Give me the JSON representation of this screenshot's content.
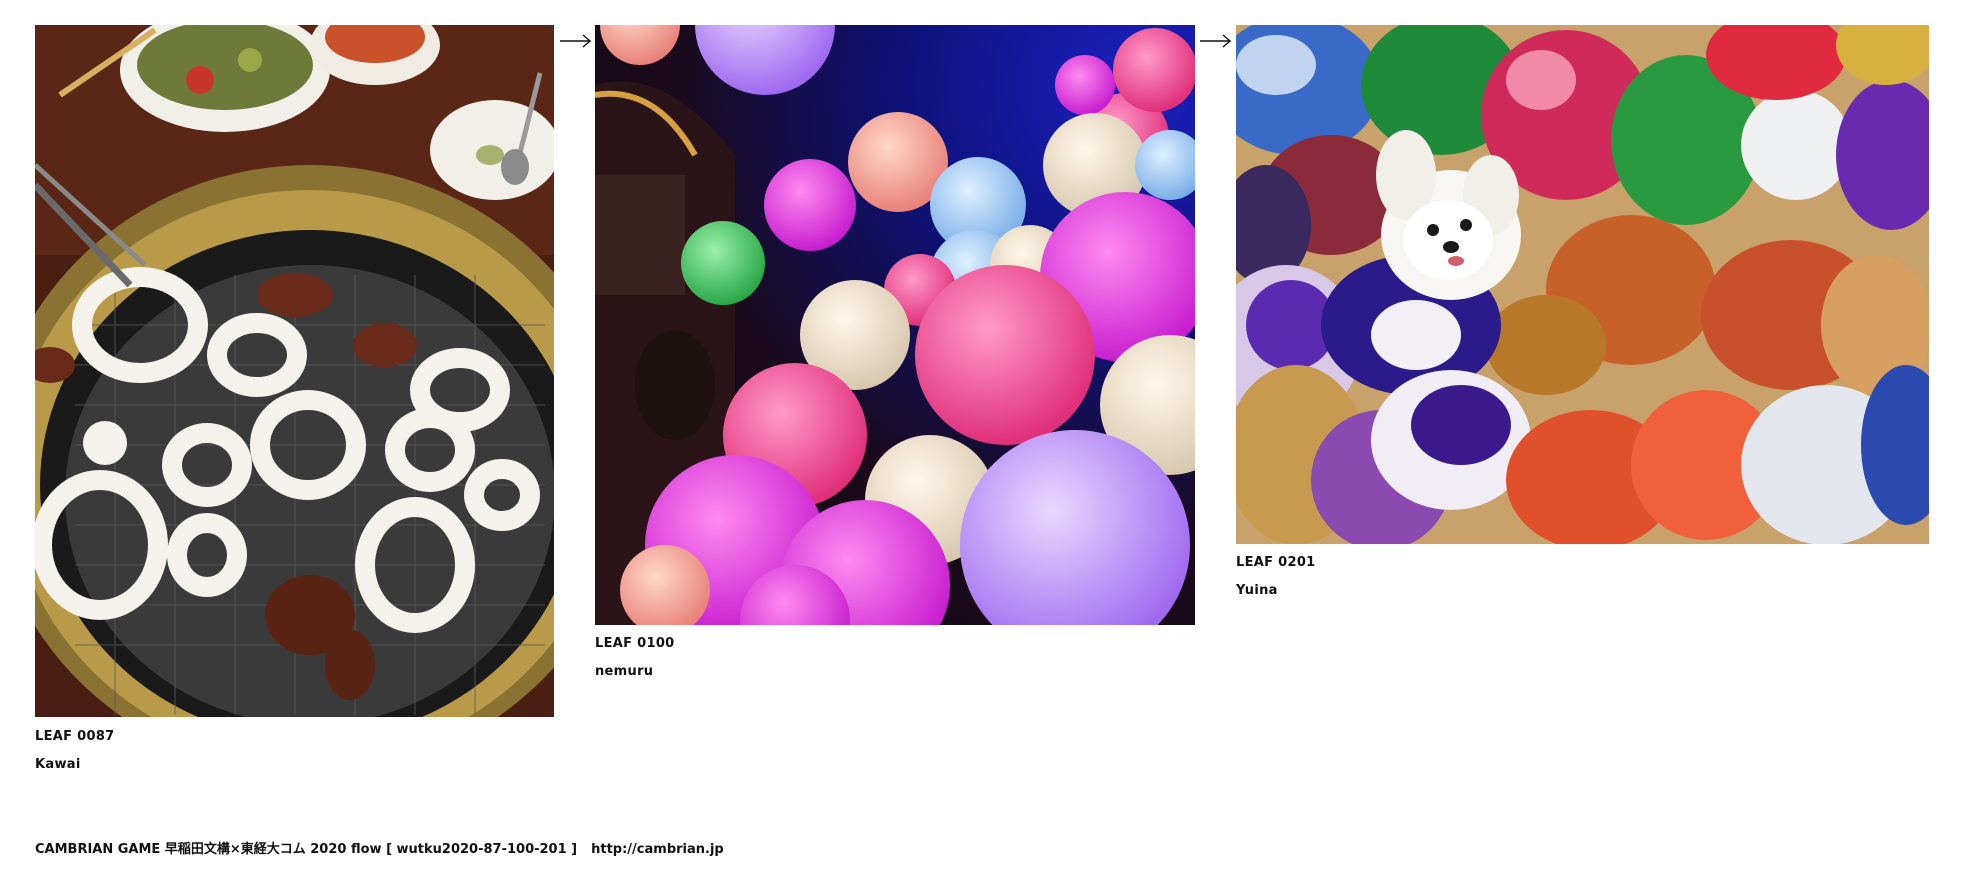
{
  "leaves": [
    {
      "id_label": "LEAF 0087",
      "author": "Kawai",
      "image": "grill-photo"
    },
    {
      "id_label": "LEAF 0100",
      "author": "nemuru",
      "image": "balloons-photo"
    },
    {
      "id_label": "LEAF 0201",
      "author": "Yuina",
      "image": "dog-pompom-photo"
    }
  ],
  "arrows": [
    "arrow-right-icon",
    "arrow-right-icon"
  ],
  "footer": {
    "text": "CAMBRIAN GAME  早稲田文構×東経大コム 2020  flow [ wutku2020-87-100-201 ]",
    "url": "http://cambrian.jp"
  },
  "colors": {
    "background": "#ffffff",
    "text": "#111111"
  }
}
